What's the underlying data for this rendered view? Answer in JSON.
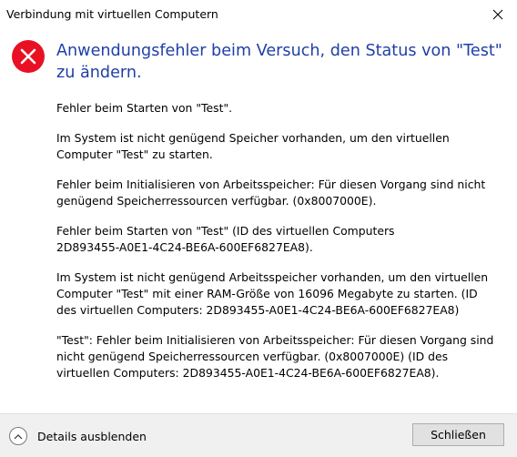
{
  "window": {
    "title": "Verbindung mit virtuellen Computern",
    "close_icon": "close-icon"
  },
  "error": {
    "icon": "error-icon",
    "heading": "Anwendungsfehler beim Versuch, den Status von \"Test\" zu ändern."
  },
  "messages": [
    "Fehler beim Starten von \"Test\".",
    "Im System ist nicht genügend Speicher vorhanden, um den virtuellen\nComputer \"Test\" zu starten.",
    "Fehler beim Initialisieren von Arbeitsspeicher: Für diesen Vorgang sind nicht\ngenügend Speicherressourcen verfügbar. (0x8007000E).",
    "Fehler beim Starten von \"Test\" (ID des virtuellen Computers\n2D893455-A0E1-4C24-BE6A-600EF6827EA8).",
    "Im System ist nicht genügend Arbeitsspeicher vorhanden, um den virtuellen\nComputer \"Test\" mit einer RAM-Größe von 16096 Megabyte zu starten. (ID\ndes virtuellen Computers: 2D893455-A0E1-4C24-BE6A-600EF6827EA8)",
    "\"Test\": Fehler beim Initialisieren von Arbeitsspeicher: Für diesen Vorgang sind\nnicht genügend Speicherressourcen verfügbar. (0x8007000E) (ID des\nvirtuellen Computers: 2D893455-A0E1-4C24-BE6A-600EF6827EA8)."
  ],
  "footer": {
    "details_label": "Details ausblenden",
    "details_icon": "chevron-up-icon",
    "close_button_label": "Schließen"
  },
  "colors": {
    "heading": "#1f3fa6",
    "error_red": "#e81123",
    "footer_bg": "#f0f0f0",
    "button_bg": "#e1e1e1"
  }
}
